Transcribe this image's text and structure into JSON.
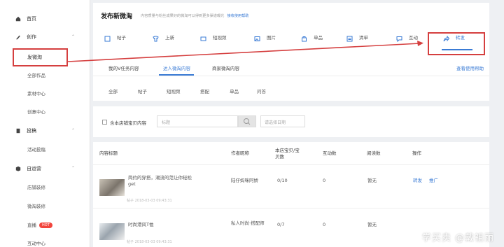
{
  "sidebar": {
    "home": "首页",
    "create": {
      "label": "创作",
      "items": [
        "发微淘",
        "全部作品",
        "素材中心",
        "创意中心"
      ]
    },
    "delivery": {
      "label": "投稿",
      "items": [
        "活动投稿"
      ]
    },
    "ops": {
      "label": "自运营",
      "items": [
        "店铺装修",
        "微淘装修",
        "直播",
        "互动中心"
      ],
      "hot_badge": "HOT"
    }
  },
  "header": {
    "title": "发布新微淘",
    "desc": "内容质量与粉丝成果好的微淘可以得到更多渠道曝光",
    "help_link": "接收使用帮助"
  },
  "post_types": [
    "帖子",
    "上新",
    "短视频",
    "图片",
    "单品",
    "清单",
    "互动",
    "转发"
  ],
  "sub_tabs": {
    "items": [
      "我的V任务内容",
      "达人微淘内容",
      "商家微淘内容"
    ],
    "help": "查看使用帮助"
  },
  "filters": [
    "全部",
    "帖子",
    "短视频",
    "搭配",
    "单品",
    "问答"
  ],
  "search": {
    "checkbox_label": "含本店铺宝贝内容",
    "keyword_label": "标题",
    "date_placeholder": "请选择日期"
  },
  "table": {
    "headers": [
      "内容标题",
      "作者昵称",
      "本店宝贝/宝贝数",
      "互动数",
      "阅读数",
      "操作"
    ],
    "rows": [
      {
        "title": "简约的穿搭，潮流的范让你轻松get",
        "meta": "帖子 2018-03-03 09:43:31",
        "author": "陆仔妈咪阿娇",
        "count": "0/10",
        "interact": "0",
        "reads": "暂无",
        "op1": "转发",
        "op2": "推广"
      },
      {
        "title": "时尚港风T恤",
        "meta": "帖子 2018-03-03 09:43:31",
        "author": "私人时尚·搭配师",
        "count": "0/7",
        "interact": "0",
        "reads": "暂无",
        "op1": "",
        "op2": ""
      }
    ]
  },
  "watermark": "学买卖 @戴祖丽",
  "colors": {
    "accent": "#3a7bd5",
    "highlight_red": "#d53f3f",
    "sidebar_bg": "#ffffff",
    "page_bg": "#eef0f3"
  }
}
